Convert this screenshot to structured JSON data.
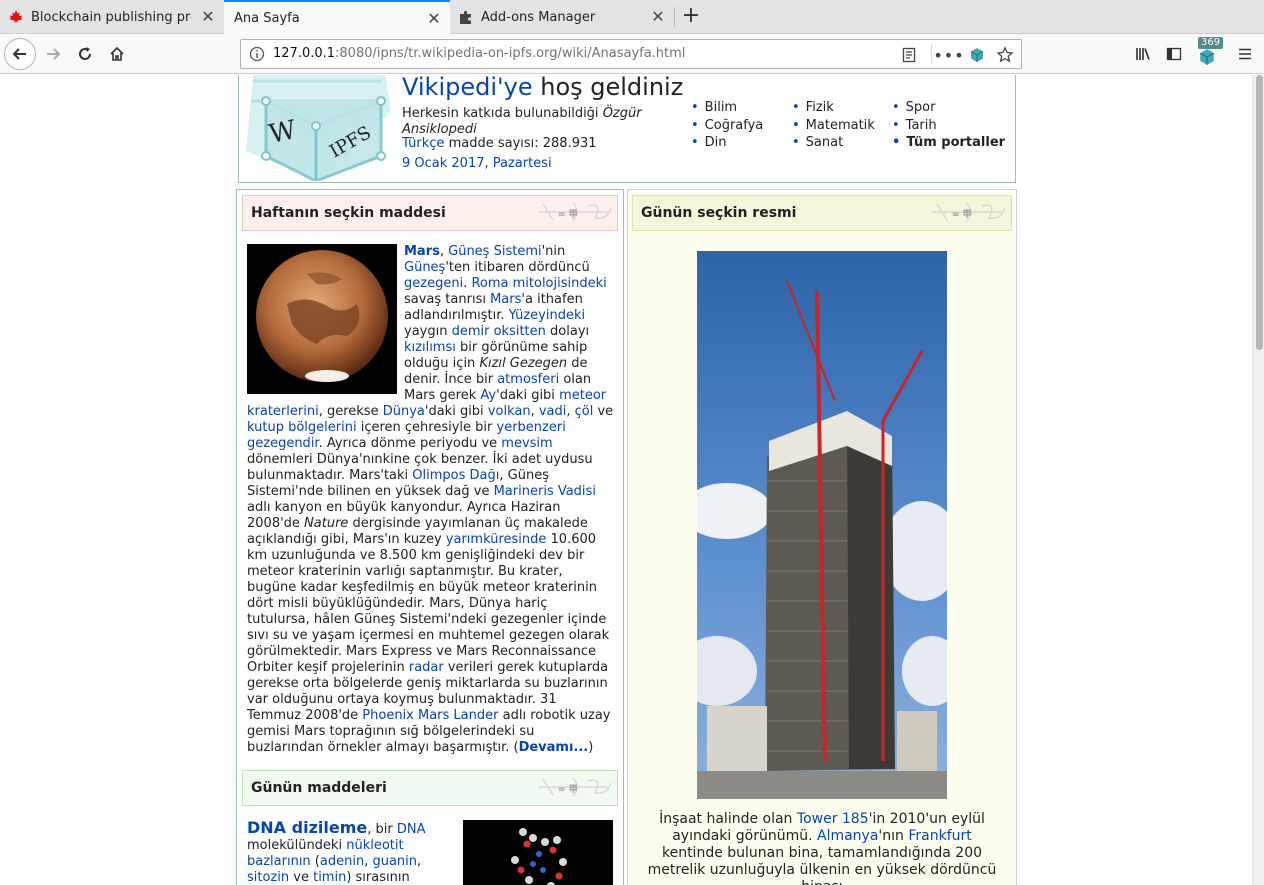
{
  "tabs": [
    {
      "title": "Blockchain publishing prot",
      "icon": "maple-leaf-icon"
    },
    {
      "title": "Ana Sayfa",
      "icon": "none"
    },
    {
      "title": "Add-ons Manager",
      "icon": "puzzle-icon"
    }
  ],
  "url": {
    "host": "127.0.0.1",
    "rest": ":8080/ipns/tr.wikipedia-on-ipfs.org/wiki/Anasayfa.html"
  },
  "toolbar": {
    "badge": "369"
  },
  "welcome": {
    "title_link": "Vikipedi'ye",
    "title_rest": "hoş geldiniz",
    "sub_plain": "Herkesin katkıda bulunabildiği",
    "sub_italic": "Özgür Ansiklopedi",
    "count_link": "Türkçe",
    "count_rest": "madde sayısı: 288.931",
    "date_link": "9 Ocak 2017",
    "date_sep": ", ",
    "date_day": "Pazartesi"
  },
  "portals": {
    "col1": [
      "Bilim",
      "Coğrafya",
      "Din"
    ],
    "col2": [
      "Fizik",
      "Matematik",
      "Sanat"
    ],
    "col3": [
      "Spor",
      "Tarih"
    ],
    "all": "Tüm portaller"
  },
  "featured": {
    "header": "Haftanın seçkin maddesi",
    "more": "Devamı..."
  },
  "daily": {
    "header": "Günün maddeleri",
    "title": "DNA dizileme",
    "t1": ", bir ",
    "l1": "DNA",
    "t2": " molekülündeki ",
    "l2": "nükleotit bazlarının",
    "t3": " (",
    "l3": "adenin",
    "t4": ", ",
    "l4": "guanin",
    "t5": ",",
    "l5": "sitozin",
    "t6": " ve ",
    "l6": "timin",
    "t7": ") sırasının"
  },
  "picture": {
    "header": "Günün seçkin resmi",
    "c1": "İnşaat halinde olan ",
    "l1": "Tower 185",
    "c2": "'in 2010'un eylül ayındaki görünümü. ",
    "l2": "Almanya",
    "c3": "'nın ",
    "l3": "Frankfurt",
    "c4": " kentinde bulunan bina, tamamlandığında 200 metrelik uzunluğuyla ülkenin en yüksek dördüncü binası"
  }
}
